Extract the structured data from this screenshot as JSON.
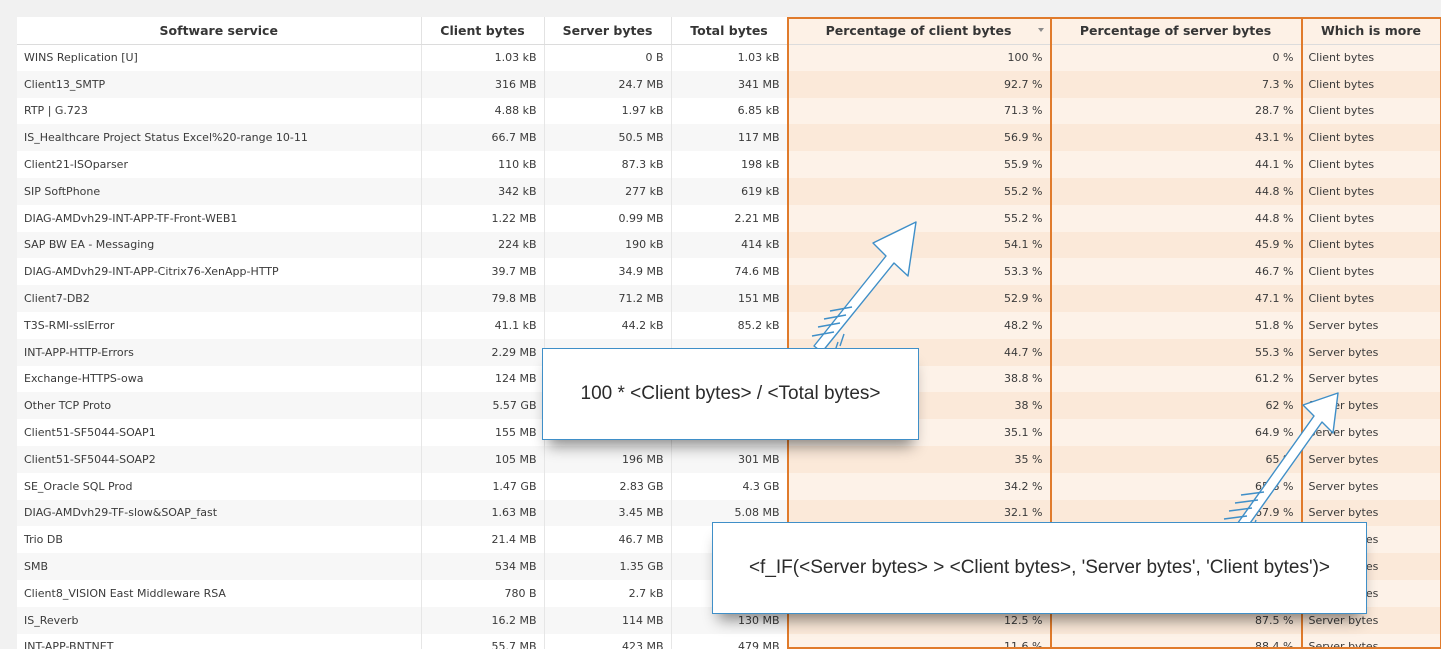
{
  "columns": [
    "Software service",
    "Client bytes",
    "Server bytes",
    "Total bytes",
    "Percentage of client bytes",
    "Percentage of server bytes",
    "Which is more"
  ],
  "rows": [
    {
      "service": "WINS Replication [U]",
      "client": "1.03 kB",
      "server": "0 B",
      "total": "1.03 kB",
      "pct_client": "100 %",
      "pct_server": "0 %",
      "more": "Client bytes"
    },
    {
      "service": "Client13_SMTP",
      "client": "316 MB",
      "server": "24.7 MB",
      "total": "341 MB",
      "pct_client": "92.7 %",
      "pct_server": "7.3 %",
      "more": "Client bytes"
    },
    {
      "service": "RTP | G.723",
      "client": "4.88 kB",
      "server": "1.97 kB",
      "total": "6.85 kB",
      "pct_client": "71.3 %",
      "pct_server": "28.7 %",
      "more": "Client bytes"
    },
    {
      "service": "IS_Healthcare Project Status Excel%20-range 10-11",
      "client": "66.7 MB",
      "server": "50.5 MB",
      "total": "117 MB",
      "pct_client": "56.9 %",
      "pct_server": "43.1 %",
      "more": "Client bytes"
    },
    {
      "service": "Client21-ISOparser",
      "client": "110 kB",
      "server": "87.3 kB",
      "total": "198 kB",
      "pct_client": "55.9 %",
      "pct_server": "44.1 %",
      "more": "Client bytes"
    },
    {
      "service": "SIP SoftPhone",
      "client": "342 kB",
      "server": "277 kB",
      "total": "619 kB",
      "pct_client": "55.2 %",
      "pct_server": "44.8 %",
      "more": "Client bytes"
    },
    {
      "service": "DIAG-AMDvh29-INT-APP-TF-Front-WEB1",
      "client": "1.22 MB",
      "server": "0.99 MB",
      "total": "2.21 MB",
      "pct_client": "55.2 %",
      "pct_server": "44.8 %",
      "more": "Client bytes"
    },
    {
      "service": "SAP BW EA - Messaging",
      "client": "224 kB",
      "server": "190 kB",
      "total": "414 kB",
      "pct_client": "54.1 %",
      "pct_server": "45.9 %",
      "more": "Client bytes"
    },
    {
      "service": "DIAG-AMDvh29-INT-APP-Citrix76-XenApp-HTTP",
      "client": "39.7 MB",
      "server": "34.9 MB",
      "total": "74.6 MB",
      "pct_client": "53.3 %",
      "pct_server": "46.7 %",
      "more": "Client bytes"
    },
    {
      "service": "Client7-DB2",
      "client": "79.8 MB",
      "server": "71.2 MB",
      "total": "151 MB",
      "pct_client": "52.9 %",
      "pct_server": "47.1 %",
      "more": "Client bytes"
    },
    {
      "service": "T3S-RMI-sslError",
      "client": "41.1 kB",
      "server": "44.2 kB",
      "total": "85.2 kB",
      "pct_client": "48.2 %",
      "pct_server": "51.8 %",
      "more": "Server bytes"
    },
    {
      "service": "INT-APP-HTTP-Errors",
      "client": "2.29 MB",
      "server": "",
      "total": "",
      "pct_client": "44.7 %",
      "pct_server": "55.3 %",
      "more": "Server bytes"
    },
    {
      "service": "Exchange-HTTPS-owa",
      "client": "124 MB",
      "server": "",
      "total": "",
      "pct_client": "38.8 %",
      "pct_server": "61.2 %",
      "more": "Server bytes"
    },
    {
      "service": "Other TCP Proto",
      "client": "5.57 GB",
      "server": "",
      "total": "",
      "pct_client": "38 %",
      "pct_server": "62 %",
      "more": "Server bytes"
    },
    {
      "service": "Client51-SF5044-SOAP1",
      "client": "155 MB",
      "server": "",
      "total": "",
      "pct_client": "35.1 %",
      "pct_server": "64.9 %",
      "more": "Server bytes"
    },
    {
      "service": "Client51-SF5044-SOAP2",
      "client": "105 MB",
      "server": "196 MB",
      "total": "301 MB",
      "pct_client": "35 %",
      "pct_server": "65 %",
      "more": "Server bytes"
    },
    {
      "service": "SE_Oracle SQL Prod",
      "client": "1.47 GB",
      "server": "2.83 GB",
      "total": "4.3 GB",
      "pct_client": "34.2 %",
      "pct_server": "65.8 %",
      "more": "Server bytes"
    },
    {
      "service": "DIAG-AMDvh29-TF-slow&SOAP_fast",
      "client": "1.63 MB",
      "server": "3.45 MB",
      "total": "5.08 MB",
      "pct_client": "32.1 %",
      "pct_server": "67.9 %",
      "more": "Server bytes"
    },
    {
      "service": "Trio DB",
      "client": "21.4 MB",
      "server": "46.7 MB",
      "total": "",
      "pct_client": "",
      "pct_server": "",
      "more": "Server bytes"
    },
    {
      "service": "SMB",
      "client": "534 MB",
      "server": "1.35 GB",
      "total": "",
      "pct_client": "",
      "pct_server": "",
      "more": "Server bytes"
    },
    {
      "service": "Client8_VISION East Middleware RSA",
      "client": "780 B",
      "server": "2.7 kB",
      "total": "",
      "pct_client": "",
      "pct_server": "",
      "more": "Server bytes"
    },
    {
      "service": "IS_Reverb",
      "client": "16.2 MB",
      "server": "114 MB",
      "total": "130 MB",
      "pct_client": "12.5 %",
      "pct_server": "87.5 %",
      "more": "Server bytes"
    },
    {
      "service": "INT-APP-BNTNET",
      "client": "55.7 MB",
      "server": "423 MB",
      "total": "479 MB",
      "pct_client": "11.6 %",
      "pct_server": "88.4 %",
      "more": "Server bytes"
    }
  ],
  "callouts": {
    "client_formula": "100 * <Client bytes> / <Total bytes>",
    "which_formula": "<f_IF(<Server bytes> > <Client bytes>, 'Server bytes', 'Client bytes')>"
  },
  "colors": {
    "highlight_border": "#e07b2c",
    "highlight_fill": "#fdf2e8",
    "callout_border": "#3f8fc8",
    "arrow_stroke": "#3f8fc8"
  },
  "sort": {
    "column": "Percentage of client bytes",
    "direction": "descending"
  }
}
